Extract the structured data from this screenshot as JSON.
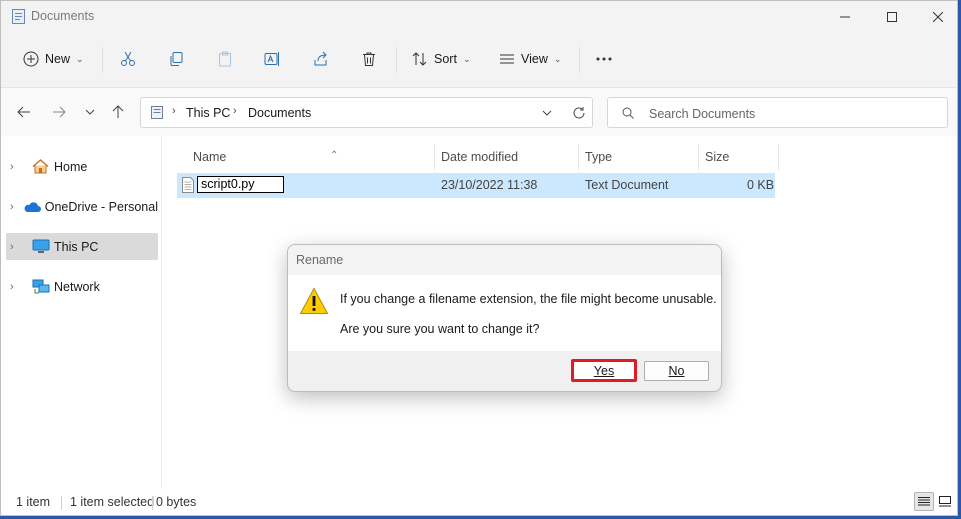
{
  "window": {
    "title": "Documents"
  },
  "toolbar": {
    "new_label": "New",
    "sort_label": "Sort",
    "view_label": "View"
  },
  "address": {
    "crumbs": [
      "This PC",
      "Documents"
    ]
  },
  "search": {
    "placeholder": "Search Documents"
  },
  "nav": {
    "items": [
      {
        "label": "Home",
        "icon": "home-icon"
      },
      {
        "label": "OneDrive - Personal",
        "icon": "cloud-icon"
      },
      {
        "label": "This PC",
        "icon": "computer-icon",
        "selected": true
      },
      {
        "label": "Network",
        "icon": "network-icon"
      }
    ]
  },
  "columns": {
    "name": "Name",
    "modified": "Date modified",
    "type": "Type",
    "size": "Size"
  },
  "files": [
    {
      "name": "script0.py",
      "modified": "23/10/2022 11:38",
      "type": "Text Document",
      "size": "0 KB"
    }
  ],
  "status": {
    "count": "1 item",
    "selected": "1 item selected",
    "bytes": "0 bytes"
  },
  "dialog": {
    "title": "Rename",
    "message": "If you change a filename extension, the file might become unusable.",
    "question": "Are you sure you want to change it?",
    "yes_label": "Yes",
    "no_label": "No"
  },
  "colors": {
    "selection": "#cce8ff",
    "highlight": "#e01b24",
    "accent": "#0067c0"
  }
}
